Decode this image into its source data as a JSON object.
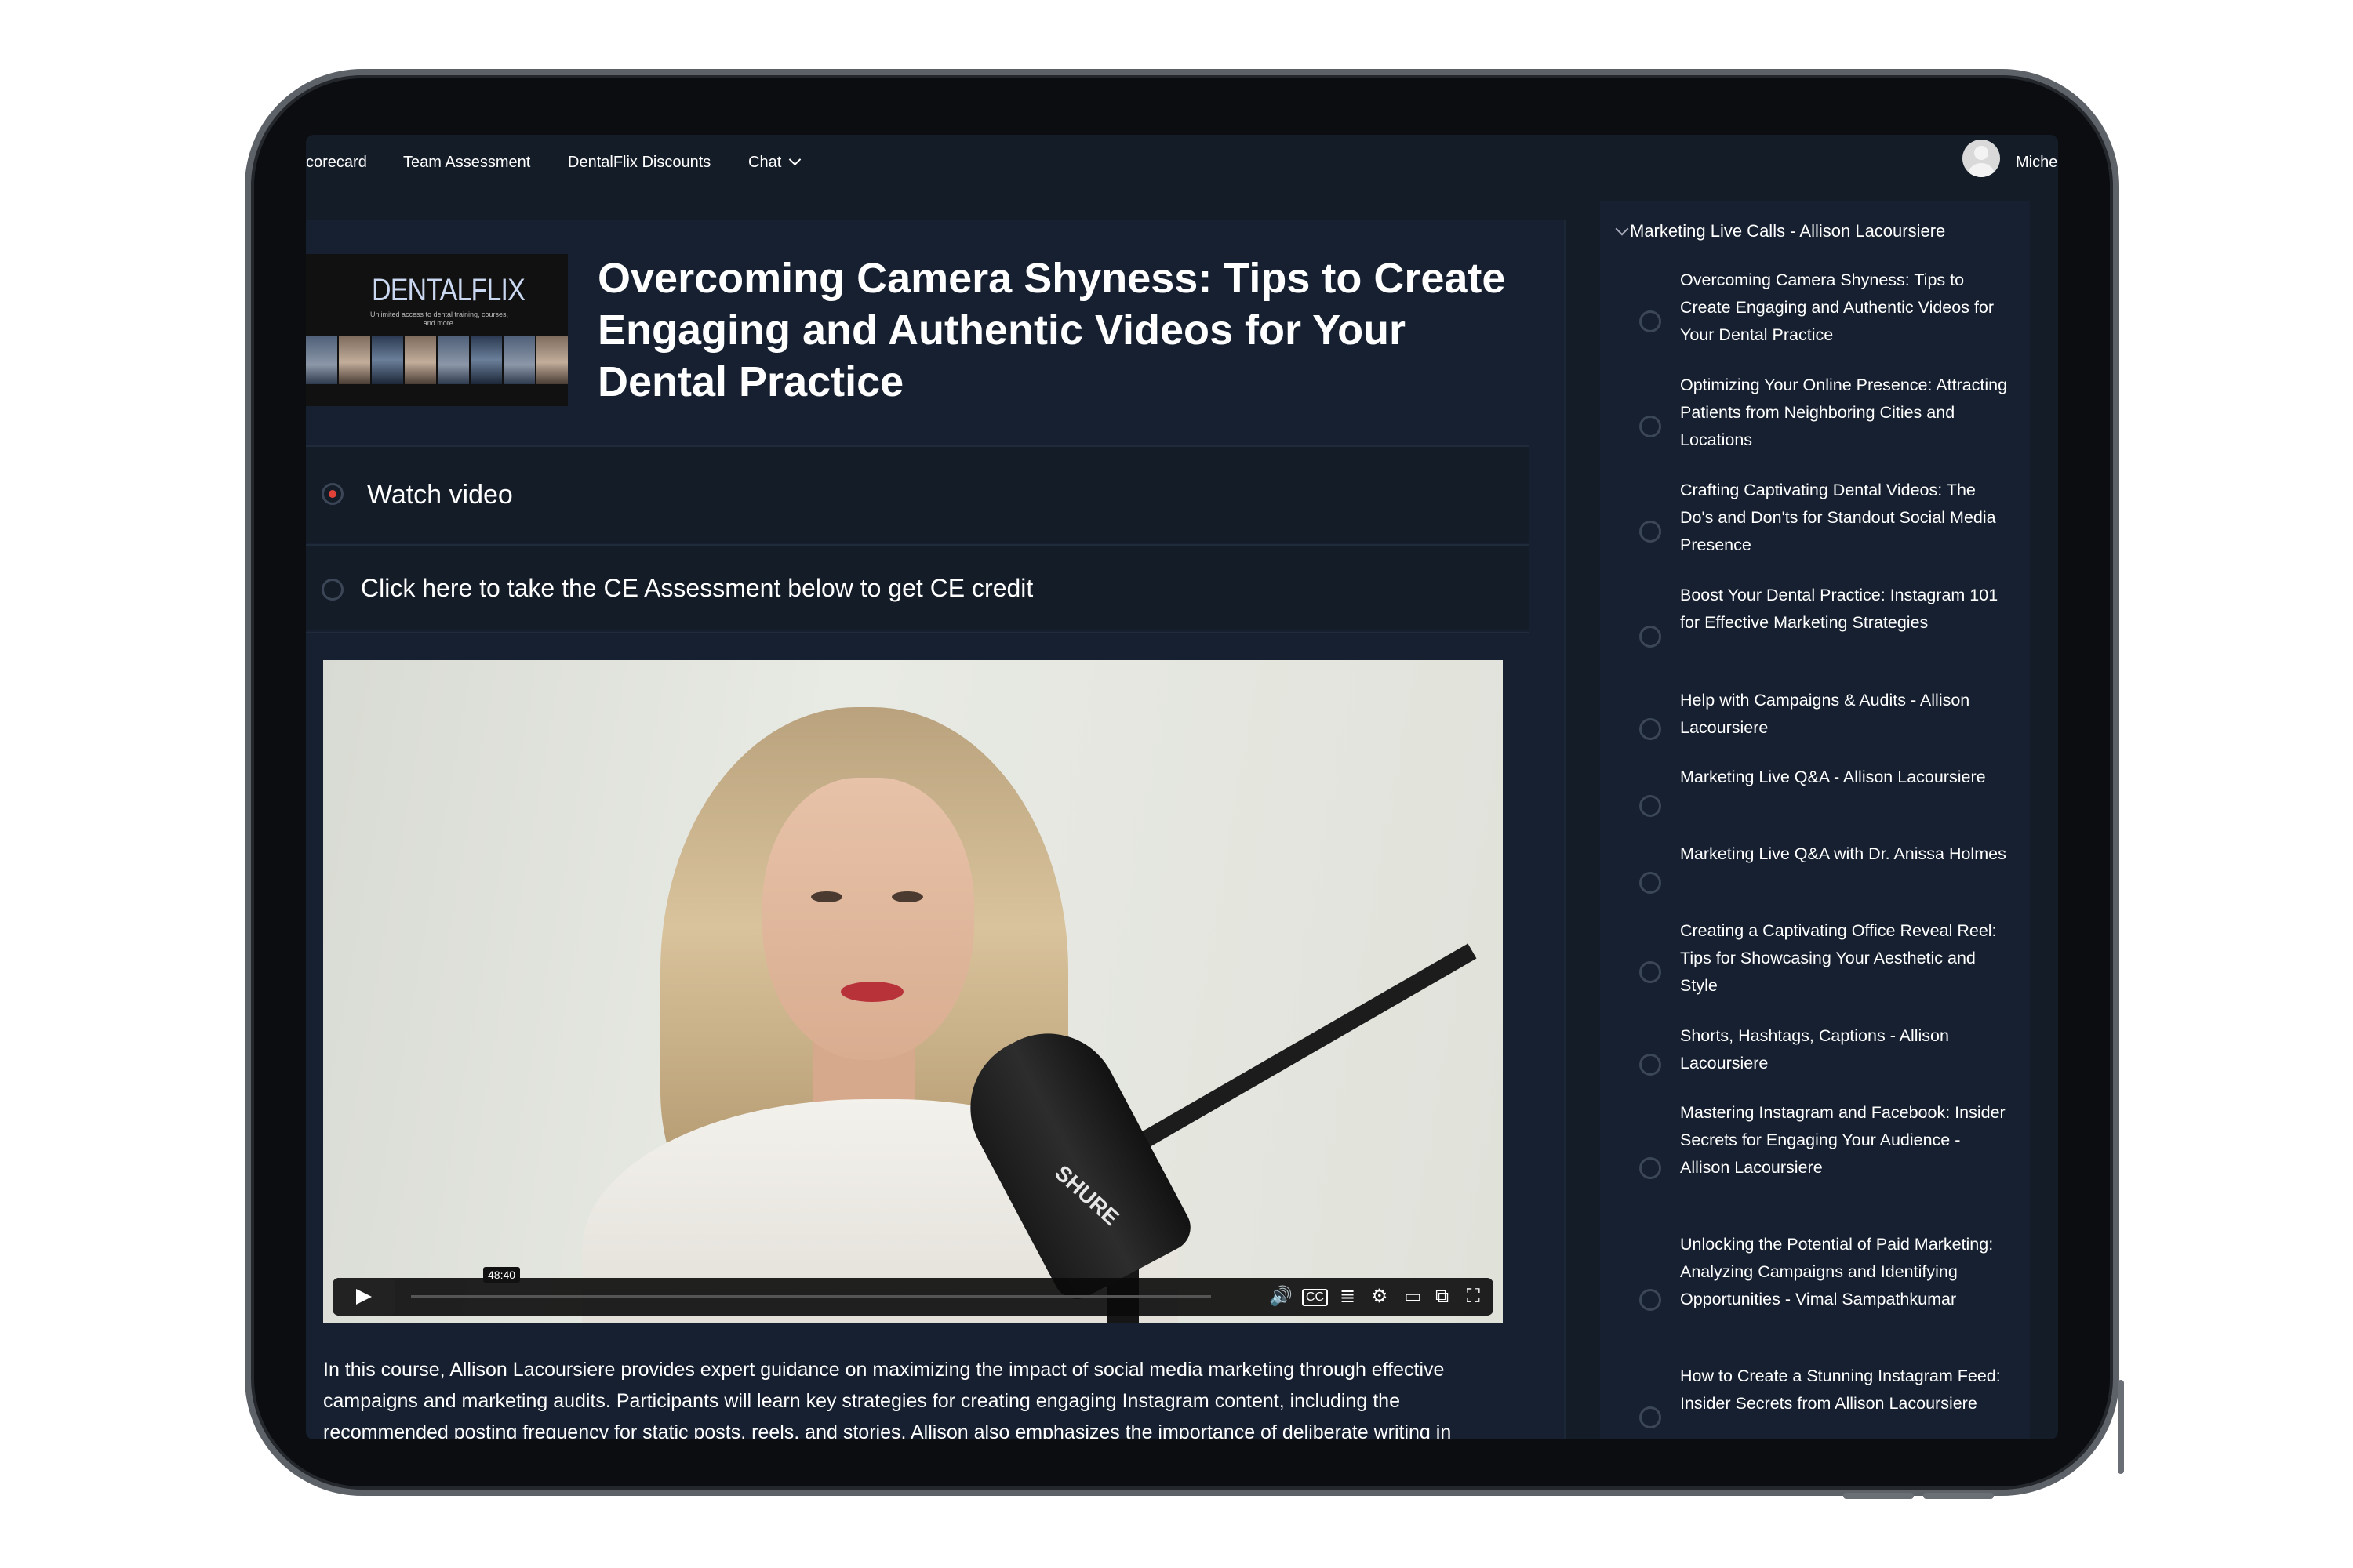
{
  "nav": {
    "links": [
      "corecard",
      "Team Assessment",
      "DentalFlix Discounts",
      "Chat"
    ],
    "user_name": "Miche"
  },
  "lesson": {
    "thumbnail_logo": "DENTALFLIX",
    "thumbnail_tagline": "Unlimited access to dental training, courses, and more.",
    "title": "Overcoming Camera Shyness: Tips to Create Engaging and Authentic Videos for Your Dental Practice",
    "steps": [
      {
        "label": "Watch video",
        "active": true
      },
      {
        "label": "Click here to take the CE Assessment below to get CE credit",
        "active": false
      }
    ],
    "video": {
      "timestamp": "48:40",
      "mic_brand": "SHURE"
    },
    "description": "In this course, Allison Lacoursiere provides expert guidance on maximizing the impact of social media marketing through effective campaigns and marketing audits. Participants will learn key strategies for creating engaging Instagram content, including the recommended posting frequency for static posts, reels, and stories. Allison also emphasizes the importance of deliberate writing in"
  },
  "sidebar": {
    "section_title": "Marketing Live Calls - Allison Lacoursiere",
    "lessons": [
      "Overcoming Camera Shyness: Tips to Create Engaging and Authentic Videos for Your Dental Practice",
      "Optimizing Your Online Presence: Attracting Patients from Neighboring Cities and Locations",
      "Crafting Captivating Dental Videos: The Do's and Don'ts for Standout Social Media Presence",
      "Boost Your Dental Practice: Instagram 101 for Effective Marketing Strategies",
      "Help with Campaigns & Audits - Allison Lacoursiere",
      "Marketing Live Q&A - Allison Lacoursiere",
      "Marketing Live Q&A with Dr. Anissa Holmes",
      "Creating a Captivating Office Reveal Reel: Tips for Showcasing Your Aesthetic and Style",
      "Shorts, Hashtags, Captions - Allison Lacoursiere",
      "Mastering Instagram and Facebook: Insider Secrets for Engaging Your Audience - Allison Lacoursiere",
      "Unlocking the Potential of Paid Marketing: Analyzing Campaigns and Identifying Opportunities - Vimal Sampathkumar",
      "How to Create a Stunning Instagram Feed: Insider Secrets from Allison Lacoursiere"
    ]
  },
  "colors": {
    "background": "#141c28",
    "panel": "#162030",
    "active_dot": "#e0423a",
    "text": "#ffffff"
  },
  "icons": [
    "chevron-down-icon",
    "user-avatar-icon",
    "play-icon",
    "volume-icon",
    "captions-icon",
    "transcript-icon",
    "settings-icon",
    "cast-icon",
    "picture-in-picture-icon",
    "fullscreen-icon"
  ]
}
